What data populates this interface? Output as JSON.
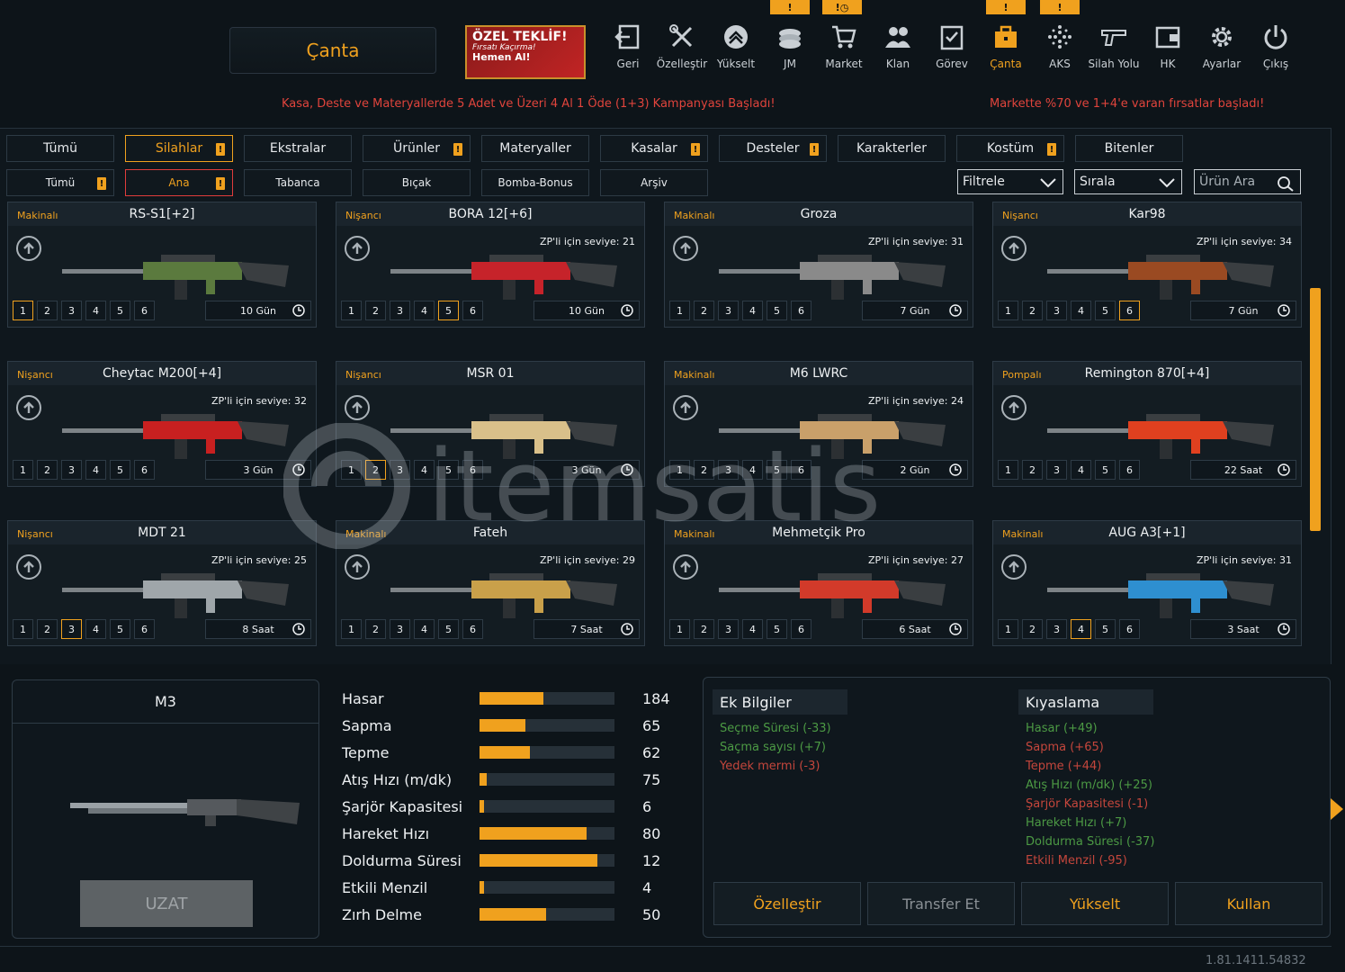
{
  "header": {
    "title": "Çanta",
    "offer": {
      "title": "ÖZEL TEKLİF!",
      "subtitle": "Fırsatı Kaçırma!",
      "cta": "Hemen Al!"
    },
    "nav": [
      {
        "label": "Geri",
        "icon": "back-icon"
      },
      {
        "label": "Özelleştir",
        "icon": "tools-icon"
      },
      {
        "label": "Yükselt",
        "icon": "upgrade-icon"
      },
      {
        "label": "JM",
        "icon": "coins-icon",
        "flag": "!"
      },
      {
        "label": "Market",
        "icon": "cart-icon",
        "flag": "!"
      },
      {
        "label": "Klan",
        "icon": "clan-icon"
      },
      {
        "label": "Görev",
        "icon": "task-icon"
      },
      {
        "label": "Çanta",
        "icon": "bag-icon",
        "flag": "!"
      },
      {
        "label": "AKS",
        "icon": "aks-icon",
        "flag": "!"
      },
      {
        "label": "Silah Yolu",
        "icon": "gun-icon"
      },
      {
        "label": "HK",
        "icon": "hk-icon"
      },
      {
        "label": "Ayarlar",
        "icon": "gear-icon"
      },
      {
        "label": "Çıkış",
        "icon": "power-icon"
      }
    ],
    "flags": {
      "jm": "!",
      "market": "!",
      "canta": "!",
      "aks": "!"
    },
    "promo_left": "Kasa, Deste ve Materyallerde 5 Adet ve Üzeri 4 Al 1 Öde (1+3) Kampanyası Başladı!",
    "promo_right": "Markette %70 ve 1+4'e varan fırsatlar başladı!"
  },
  "tabs": [
    "Tümü",
    "Silahlar",
    "Ekstralar",
    "Ürünler",
    "Materyaller",
    "Kasalar",
    "Desteler",
    "Karakterler",
    "Kostüm",
    "Bitenler"
  ],
  "subtabs": [
    "Tümü",
    "Ana",
    "Tabanca",
    "Bıçak",
    "Bomba-Bonus",
    "Arşiv"
  ],
  "filters": {
    "filter_label": "Filtrele",
    "sort_label": "Sırala",
    "search_placeholder": "Ürün Ara"
  },
  "cards": [
    {
      "class": "Makinalı",
      "name": "RS-S1[+2]",
      "level": "",
      "slot": 1,
      "duration": "10 Gün"
    },
    {
      "class": "Nişancı",
      "name": "BORA 12[+6]",
      "level": "ZP'li için seviye: 21",
      "slot": 5,
      "duration": "10 Gün"
    },
    {
      "class": "Makinalı",
      "name": "Groza",
      "level": "ZP'li için seviye: 31",
      "slot": 0,
      "duration": "7 Gün"
    },
    {
      "class": "Nişancı",
      "name": "Kar98",
      "level": "ZP'li için seviye: 34",
      "slot": 6,
      "duration": "7 Gün"
    },
    {
      "class": "Nişancı",
      "name": "Cheytac M200[+4]",
      "level": "ZP'li için seviye: 32",
      "slot": 0,
      "duration": "3 Gün"
    },
    {
      "class": "Nişancı",
      "name": "MSR 01",
      "level": "",
      "slot": 2,
      "duration": "3 Gün"
    },
    {
      "class": "Makinalı",
      "name": "M6 LWRC",
      "level": "ZP'li için seviye: 24",
      "slot": 0,
      "duration": "2 Gün"
    },
    {
      "class": "Pompalı",
      "name": "Remington 870[+4]",
      "level": "",
      "slot": 0,
      "duration": "22 Saat"
    },
    {
      "class": "Nişancı",
      "name": "MDT 21",
      "level": "ZP'li için seviye: 25",
      "slot": 3,
      "duration": "8 Saat"
    },
    {
      "class": "Makinalı",
      "name": "Fateh",
      "level": "ZP'li için seviye: 29",
      "slot": 0,
      "duration": "7 Saat"
    },
    {
      "class": "Makinalı",
      "name": "Mehmetçik Pro",
      "level": "ZP'li için seviye: 27",
      "slot": 0,
      "duration": "6 Saat"
    },
    {
      "class": "Makinalı",
      "name": "AUG A3[+1]",
      "level": "ZP'li için seviye: 31",
      "slot": 4,
      "duration": "3 Saat"
    }
  ],
  "slot_labels": [
    "1",
    "2",
    "3",
    "4",
    "5",
    "6"
  ],
  "selected": {
    "name": "M3",
    "extend_label": "UZAT",
    "stats": [
      {
        "label": "Hasar",
        "value": "184",
        "fill": 0.47
      },
      {
        "label": "Sapma",
        "value": "65",
        "fill": 0.34
      },
      {
        "label": "Tepme",
        "value": "62",
        "fill": 0.37
      },
      {
        "label": "Atış Hızı (m/dk)",
        "value": "75",
        "fill": 0.05
      },
      {
        "label": "Şarjör Kapasitesi",
        "value": "6",
        "fill": 0.03
      },
      {
        "label": "Hareket Hızı",
        "value": "80",
        "fill": 0.79
      },
      {
        "label": "Doldurma Süresi",
        "value": "12",
        "fill": 0.87
      },
      {
        "label": "Etkili Menzil",
        "value": "4",
        "fill": 0.03
      },
      {
        "label": "Zırh Delme",
        "value": "50",
        "fill": 0.49
      }
    ]
  },
  "info": {
    "extra_title": "Ek Bilgiler",
    "extra": [
      {
        "text": "Seçme Süresi (-33)",
        "tone": "pos"
      },
      {
        "text": "Saçma sayısı (+7)",
        "tone": "pos"
      },
      {
        "text": "Yedek mermi (-3)",
        "tone": "neg"
      }
    ],
    "compare_title": "Kıyaslama",
    "compare": [
      {
        "text": "Hasar (+49)",
        "tone": "pos"
      },
      {
        "text": "Sapma (+65)",
        "tone": "neg"
      },
      {
        "text": "Tepme (+44)",
        "tone": "neg"
      },
      {
        "text": "Atış Hızı (m/dk) (+25)",
        "tone": "pos"
      },
      {
        "text": "Şarjör Kapasitesi (-1)",
        "tone": "neg"
      },
      {
        "text": "Hareket Hızı (+7)",
        "tone": "pos"
      },
      {
        "text": "Doldurma Süresi (-37)",
        "tone": "pos"
      },
      {
        "text": "Etkili Menzil (-95)",
        "tone": "neg"
      }
    ],
    "actions": [
      "Özelleştir",
      "Transfer Et",
      "Yükselt",
      "Kullan"
    ]
  },
  "watermark": "itemsatis",
  "version": "1.81.1411.54832",
  "colors": {
    "accent": "#f0a11e",
    "positive": "#4c9a44",
    "negative": "#c4463c",
    "background": "#0d1419"
  }
}
